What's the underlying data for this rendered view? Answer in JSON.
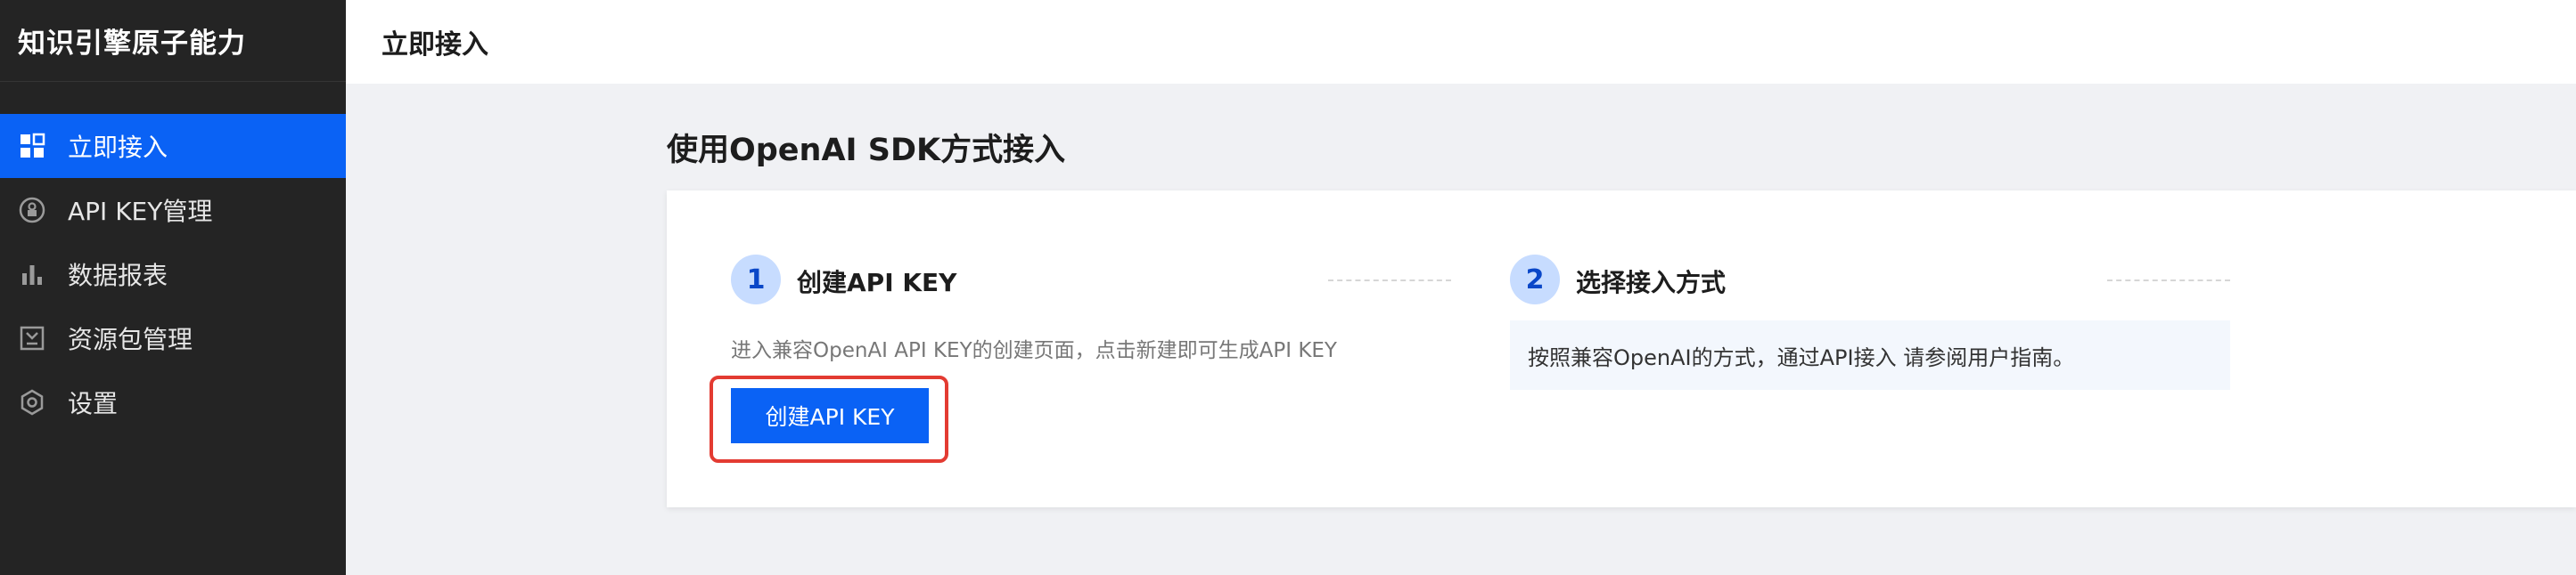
{
  "app": {
    "title": "知识引擎原子能力"
  },
  "sidebar": {
    "items": [
      {
        "label": "立即接入",
        "icon": "grid-icon",
        "active": true
      },
      {
        "label": "API KEY管理",
        "icon": "key-lock-icon",
        "active": false
      },
      {
        "label": "数据报表",
        "icon": "bar-chart-icon",
        "active": false
      },
      {
        "label": "资源包管理",
        "icon": "package-icon",
        "active": false
      },
      {
        "label": "设置",
        "icon": "gear-icon",
        "active": false
      }
    ]
  },
  "header": {
    "title": "立即接入"
  },
  "main": {
    "section_title": "使用OpenAI SDK方式接入",
    "steps": [
      {
        "number": "1",
        "title": "创建API KEY",
        "description": "进入兼容OpenAI API KEY的创建页面，点击新建即可生成API KEY",
        "button_label": "创建API KEY"
      },
      {
        "number": "2",
        "title": "选择接入方式",
        "description": "按照兼容OpenAI的方式，通过API接入 请参阅用户指南。"
      }
    ]
  },
  "colors": {
    "primary": "#0a62f5",
    "sidebar_bg": "#242424",
    "highlight_border": "#e33b32",
    "step_badge_bg": "#c7dcff"
  }
}
